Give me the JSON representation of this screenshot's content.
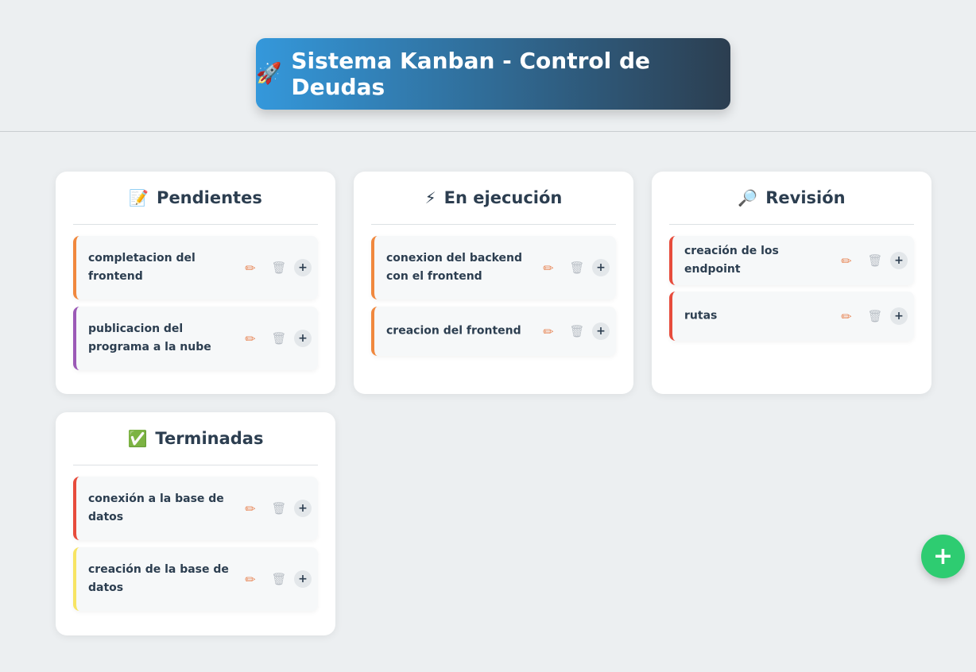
{
  "header": {
    "icon": "rocket-icon",
    "icon_glyph": "🚀",
    "title": "Sistema Kanban - Control de Deudas"
  },
  "columns": [
    {
      "title": "Pendientes",
      "icon": "memo-icon",
      "icon_glyph": "📝",
      "cards": [
        {
          "text": "completacion del frontend",
          "accent": "#f0883e"
        },
        {
          "text": "publicacion del programa a la nube",
          "accent": "#9b59b6"
        }
      ]
    },
    {
      "title": "En ejecución",
      "icon": "lightning-icon",
      "icon_glyph": "⚡",
      "cards": [
        {
          "text": "conexion del backend con el frontend",
          "accent": "#f0883e"
        },
        {
          "text": "creacion del frontend",
          "accent": "#f0883e"
        }
      ]
    },
    {
      "title": "Revisión",
      "icon": "magnifier-icon",
      "icon_glyph": "🔎",
      "cards": [
        {
          "text": "creación de los endpoint",
          "accent": "#e74c3c"
        },
        {
          "text": "rutas",
          "accent": "#e74c3c"
        }
      ]
    },
    {
      "title": "Terminadas",
      "icon": "checkmark-icon",
      "icon_glyph": "✅",
      "cards": [
        {
          "text": "conexión a la base de datos",
          "accent": "#e74c3c"
        },
        {
          "text": "creación de la base de datos",
          "accent": "#f7e463"
        }
      ]
    }
  ],
  "card_actions": {
    "edit_icon": "pencil-icon",
    "edit_glyph": "✏",
    "delete_icon": "trash-icon",
    "delete_glyph": "🗑",
    "add_icon": "plus-icon",
    "add_glyph": "+"
  },
  "fab": {
    "icon": "plus-icon",
    "glyph": "+",
    "color": "#2ecc71"
  }
}
